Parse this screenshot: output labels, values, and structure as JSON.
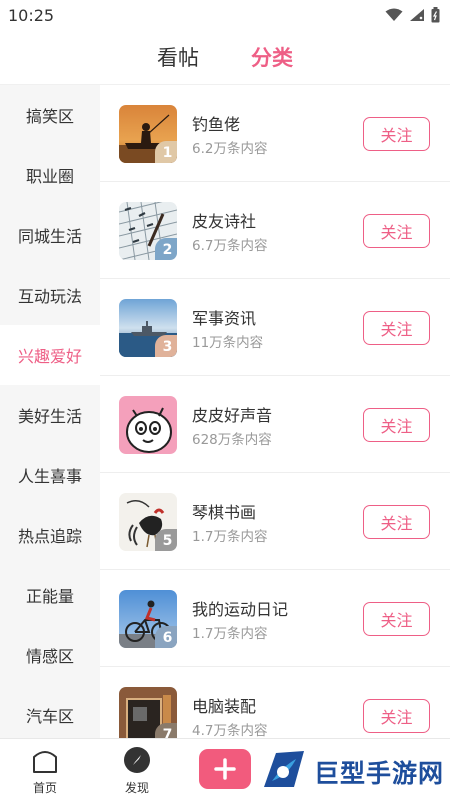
{
  "status_bar": {
    "time": "10:25"
  },
  "top_tabs": [
    {
      "label": "看帖",
      "active": false
    },
    {
      "label": "分类",
      "active": true
    }
  ],
  "sidebar": {
    "items": [
      {
        "label": "搞笑区",
        "active": false
      },
      {
        "label": "职业圈",
        "active": false
      },
      {
        "label": "同城生活",
        "active": false
      },
      {
        "label": "互动玩法",
        "active": false
      },
      {
        "label": "兴趣爱好",
        "active": true
      },
      {
        "label": "美好生活",
        "active": false
      },
      {
        "label": "人生喜事",
        "active": false
      },
      {
        "label": "热点追踪",
        "active": false
      },
      {
        "label": "正能量",
        "active": false
      },
      {
        "label": "情感区",
        "active": false
      },
      {
        "label": "汽车区",
        "active": false
      }
    ]
  },
  "list": {
    "items": [
      {
        "rank": "1",
        "title": "钓鱼佬",
        "count": "6.2万条内容",
        "follow_label": "关注",
        "thumb_icon": "fishing-sunset-thumb"
      },
      {
        "rank": "2",
        "title": "皮友诗社",
        "count": "6.7万条内容",
        "follow_label": "关注",
        "thumb_icon": "calligraphy-thumb"
      },
      {
        "rank": "3",
        "title": "军事资讯",
        "count": "11万条内容",
        "follow_label": "关注",
        "thumb_icon": "warship-thumb"
      },
      {
        "rank": "",
        "title": "皮皮好声音",
        "count": "628万条内容",
        "follow_label": "关注",
        "thumb_icon": "cartoon-face-thumb"
      },
      {
        "rank": "5",
        "title": "琴棋书画",
        "count": "1.7万条内容",
        "follow_label": "关注",
        "thumb_icon": "rooster-painting-thumb"
      },
      {
        "rank": "6",
        "title": "我的运动日记",
        "count": "1.7万条内容",
        "follow_label": "关注",
        "thumb_icon": "cyclist-thumb"
      },
      {
        "rank": "7",
        "title": "电脑装配",
        "count": "4.7万条内容",
        "follow_label": "关注",
        "thumb_icon": "pc-parts-thumb"
      }
    ]
  },
  "bottom_nav": {
    "home_label": "首页",
    "discover_label": "发现",
    "post_icon": "plus-icon"
  },
  "watermark": {
    "text": "巨型手游网"
  },
  "colors": {
    "accent": "#ee5f86",
    "post_button": "#f25b7d",
    "watermark": "#1e4e9c"
  }
}
